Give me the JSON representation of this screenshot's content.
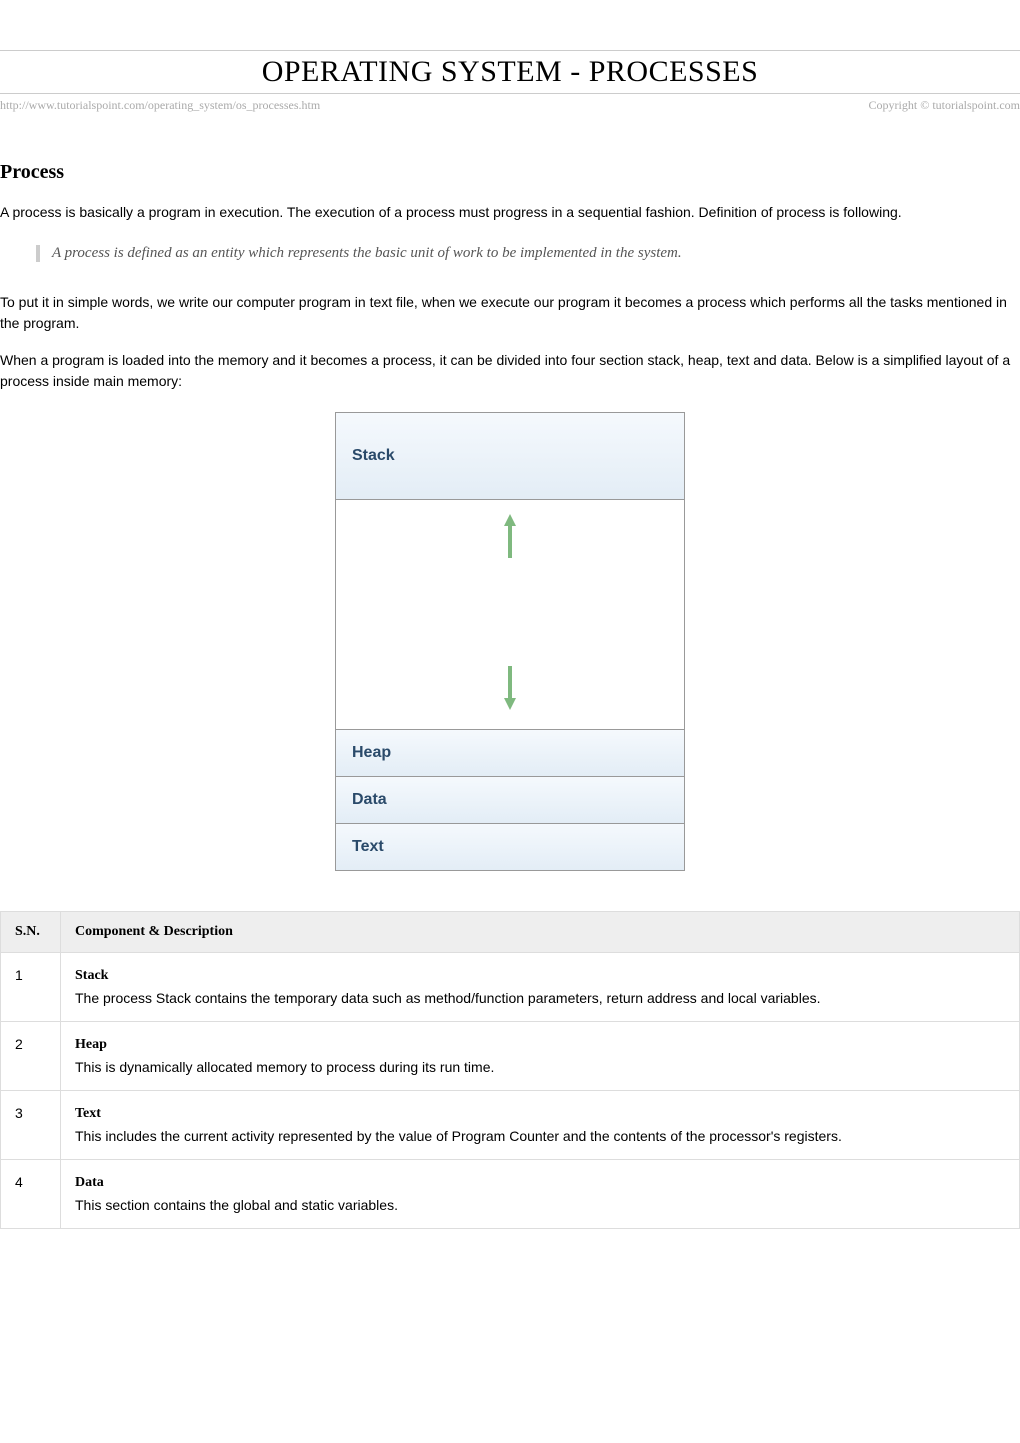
{
  "title": "OPERATING SYSTEM - PROCESSES",
  "meta": {
    "url": "http://www.tutorialspoint.com/operating_system/os_processes.htm",
    "copyright": "Copyright © tutorialspoint.com"
  },
  "section": {
    "heading": "Process",
    "p1": "A process is basically a program in execution. The execution of a process must progress in a sequential fashion. Definition of process is following.",
    "quote": "A process is defined as an entity which represents the basic unit of work to be implemented in the system.",
    "p2": "To put it in simple words, we write our computer program in text file, when we execute our program it becomes a process which performs all the tasks mentioned in the program.",
    "p3": "When a program is loaded into the memory and it becomes a process, it can be divided into four section stack, heap, text and data. Below is a simplified layout of a process inside main memory:"
  },
  "diagram": {
    "stack": "Stack",
    "heap": "Heap",
    "data": "Data",
    "text": "Text"
  },
  "table": {
    "headers": {
      "sn": "S.N.",
      "comp": "Component & Description"
    },
    "rows": [
      {
        "sn": "1",
        "name": "Stack",
        "desc": "The process Stack contains the temporary data such as method/function parameters, return address and local variables."
      },
      {
        "sn": "2",
        "name": "Heap",
        "desc": "This is dynamically allocated memory to process during its run time."
      },
      {
        "sn": "3",
        "name": "Text",
        "desc": "This includes the current activity represented by the value of Program Counter and the contents of the processor's registers."
      },
      {
        "sn": "4",
        "name": "Data",
        "desc": "This section contains the global and static variables."
      }
    ]
  }
}
